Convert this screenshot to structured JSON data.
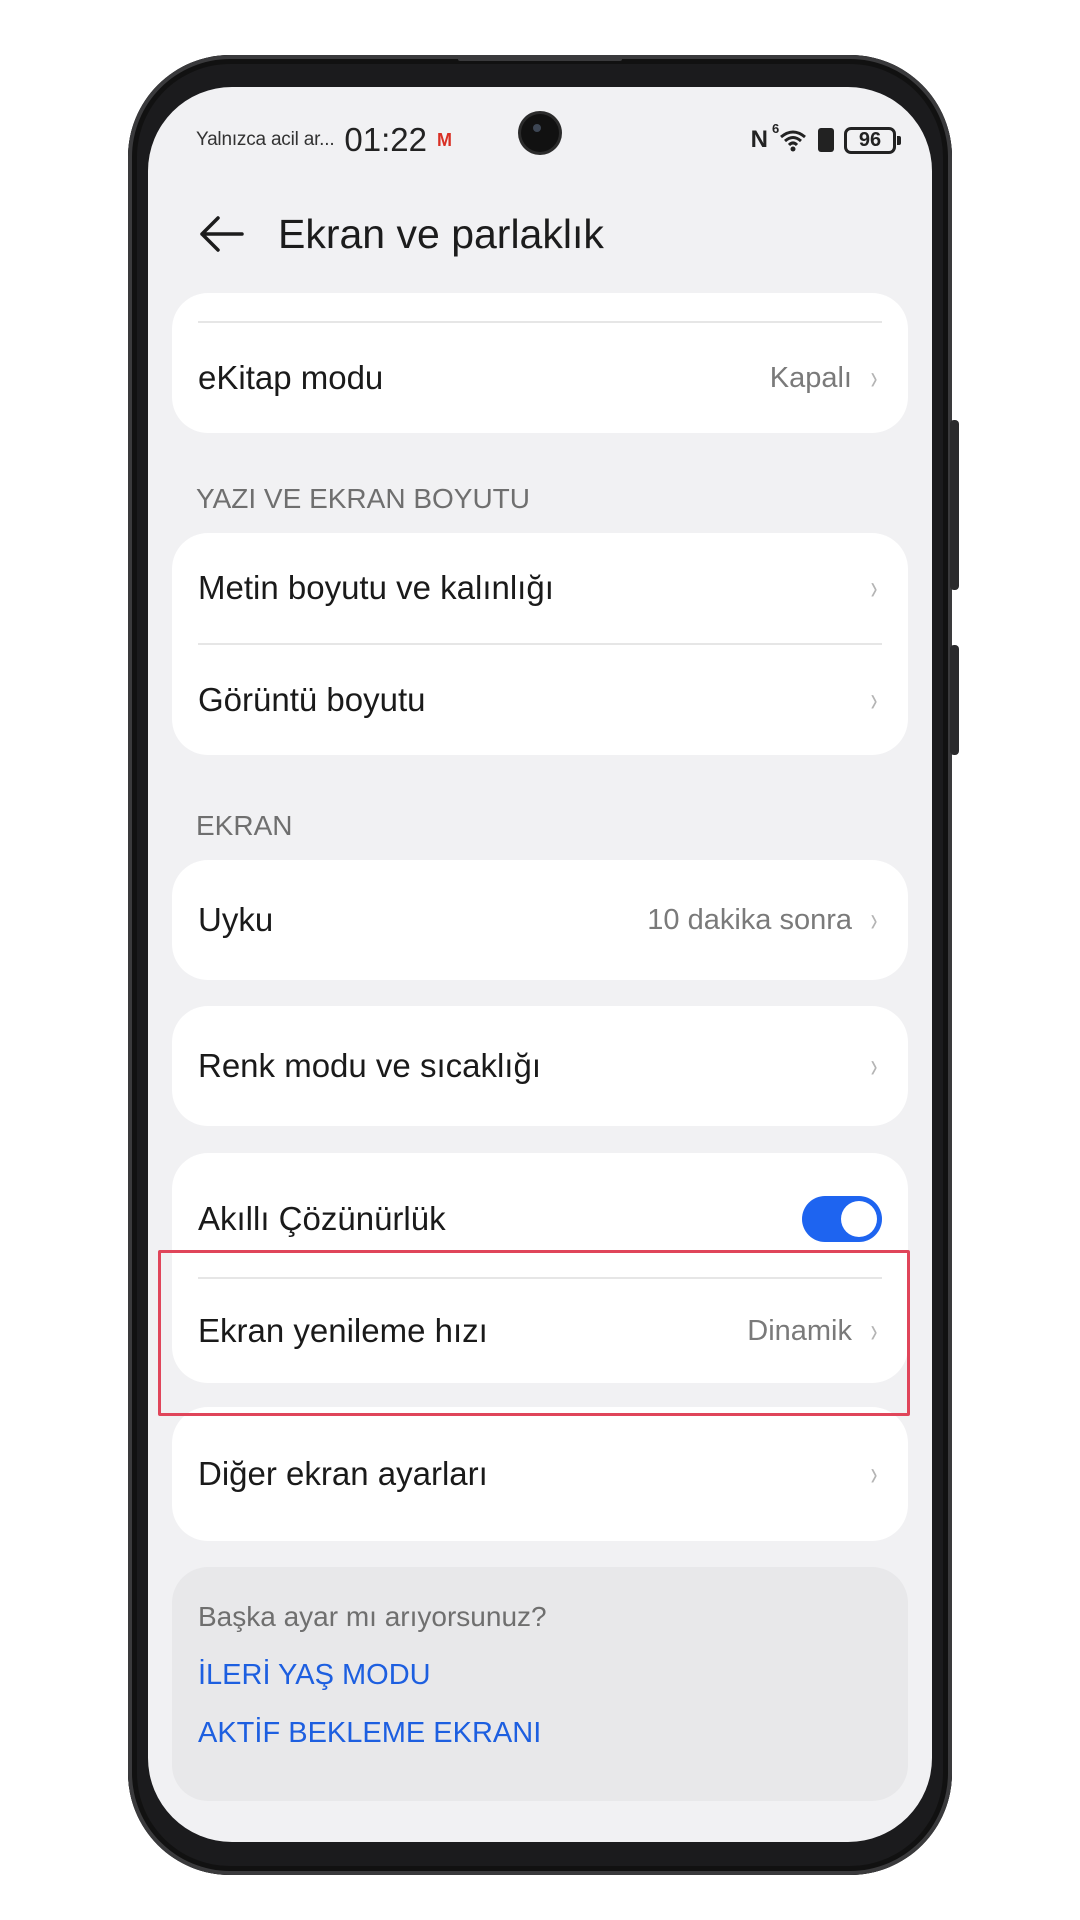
{
  "status_bar": {
    "carrier": "Yalnızca acil ar...",
    "time": "01:22",
    "mail_glyph": "M",
    "nfc_glyph": "N",
    "wifi_glyph": "⌔",
    "wifi_sup": "6",
    "battery": "96"
  },
  "header": {
    "title": "Ekran ve parlaklık"
  },
  "rows": {
    "ebook": {
      "label": "eKitap modu",
      "value": "Kapalı"
    },
    "text_size": {
      "label": "Metin boyutu ve kalınlığı"
    },
    "display_size": {
      "label": "Görüntü boyutu"
    },
    "sleep": {
      "label": "Uyku",
      "value": "10 dakika sonra"
    },
    "color_mode": {
      "label": "Renk modu ve sıcaklığı"
    },
    "smart_resolution": {
      "label": "Akıllı Çözünürlük",
      "toggle_on": true
    },
    "refresh_rate": {
      "label": "Ekran yenileme hızı",
      "value": "Dinamik"
    },
    "other": {
      "label": "Diğer ekran ayarları"
    }
  },
  "sections": {
    "text_display": "YAZI VE EKRAN BOYUTU",
    "screen": "EKRAN"
  },
  "suggestions": {
    "title": "Başka ayar mı arıyorsunuz?",
    "link1": "İLERİ YAŞ MODU",
    "link2": "AKTİF BEKLEME EKRANI"
  },
  "chevron": "›",
  "icons": {
    "back": "back-arrow-icon",
    "chevron": "chevron-right-icon",
    "nfc": "nfc-icon",
    "wifi": "wifi-icon",
    "battery": "battery-icon",
    "mail": "gmail-icon"
  },
  "colors": {
    "accent": "#1e64f0",
    "link": "#1d5fe0",
    "highlight_border": "#e0455a"
  }
}
